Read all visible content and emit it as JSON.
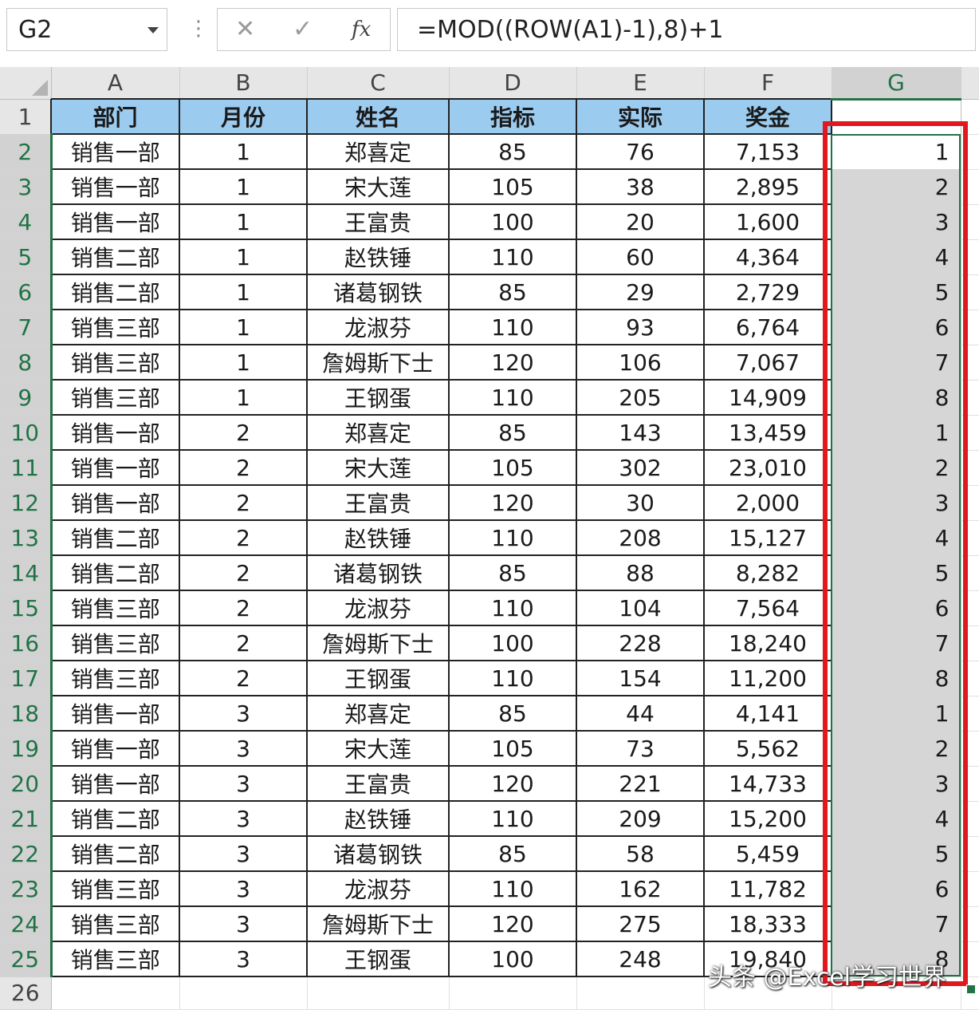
{
  "formula_bar": {
    "name_box": "G2",
    "more_icon": "vertical-dots",
    "cancel_icon": "✕",
    "enter_icon": "✓",
    "fx_label": "fx",
    "formula": "=MOD((ROW(A1)-1),8)+1"
  },
  "columns": [
    "A",
    "B",
    "C",
    "D",
    "E",
    "F",
    "G"
  ],
  "header_row": [
    "部门",
    "月份",
    "姓名",
    "指标",
    "实际",
    "奖金"
  ],
  "rows": [
    [
      "销售一部",
      "1",
      "郑喜定",
      "85",
      "76",
      "7,153",
      "1"
    ],
    [
      "销售一部",
      "1",
      "宋大莲",
      "105",
      "38",
      "2,895",
      "2"
    ],
    [
      "销售一部",
      "1",
      "王富贵",
      "100",
      "20",
      "1,600",
      "3"
    ],
    [
      "销售二部",
      "1",
      "赵铁锤",
      "110",
      "60",
      "4,364",
      "4"
    ],
    [
      "销售二部",
      "1",
      "诸葛钢铁",
      "85",
      "29",
      "2,729",
      "5"
    ],
    [
      "销售三部",
      "1",
      "龙淑芬",
      "110",
      "93",
      "6,764",
      "6"
    ],
    [
      "销售三部",
      "1",
      "詹姆斯下士",
      "120",
      "106",
      "7,067",
      "7"
    ],
    [
      "销售三部",
      "1",
      "王钢蛋",
      "110",
      "205",
      "14,909",
      "8"
    ],
    [
      "销售一部",
      "2",
      "郑喜定",
      "85",
      "143",
      "13,459",
      "1"
    ],
    [
      "销售一部",
      "2",
      "宋大莲",
      "105",
      "302",
      "23,010",
      "2"
    ],
    [
      "销售一部",
      "2",
      "王富贵",
      "120",
      "30",
      "2,000",
      "3"
    ],
    [
      "销售二部",
      "2",
      "赵铁锤",
      "110",
      "208",
      "15,127",
      "4"
    ],
    [
      "销售二部",
      "2",
      "诸葛钢铁",
      "85",
      "88",
      "8,282",
      "5"
    ],
    [
      "销售三部",
      "2",
      "龙淑芬",
      "110",
      "104",
      "7,564",
      "6"
    ],
    [
      "销售三部",
      "2",
      "詹姆斯下士",
      "100",
      "228",
      "18,240",
      "7"
    ],
    [
      "销售三部",
      "2",
      "王钢蛋",
      "110",
      "154",
      "11,200",
      "8"
    ],
    [
      "销售一部",
      "3",
      "郑喜定",
      "85",
      "44",
      "4,141",
      "1"
    ],
    [
      "销售一部",
      "3",
      "宋大莲",
      "105",
      "73",
      "5,562",
      "2"
    ],
    [
      "销售一部",
      "3",
      "王富贵",
      "120",
      "221",
      "14,733",
      "3"
    ],
    [
      "销售二部",
      "3",
      "赵铁锤",
      "110",
      "209",
      "15,200",
      "4"
    ],
    [
      "销售二部",
      "3",
      "诸葛钢铁",
      "85",
      "58",
      "5,459",
      "5"
    ],
    [
      "销售三部",
      "3",
      "龙淑芬",
      "110",
      "162",
      "11,782",
      "6"
    ],
    [
      "销售三部",
      "3",
      "詹姆斯下士",
      "120",
      "275",
      "18,333",
      "7"
    ],
    [
      "销售三部",
      "3",
      "王钢蛋",
      "100",
      "248",
      "19,840",
      "8"
    ]
  ],
  "watermark": "头条 @Excel学习世界",
  "colors": {
    "header_fill": "#9ccbf0",
    "highlight_border": "#e0191f",
    "selection_green": "#217346",
    "selected_range_fill": "#d6d6d6"
  }
}
